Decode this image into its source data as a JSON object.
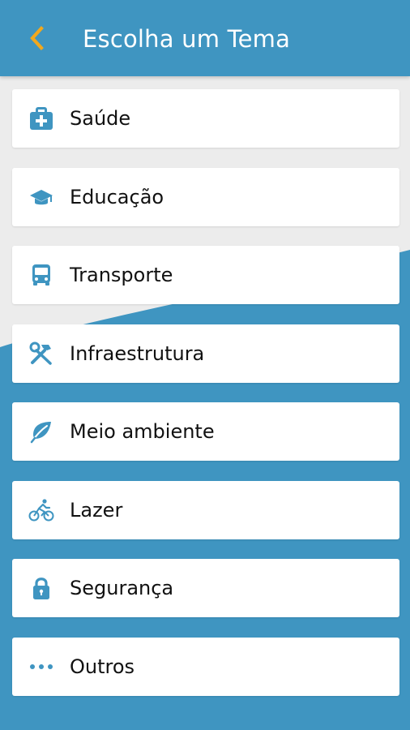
{
  "header": {
    "title": "Escolha um Tema",
    "back_icon": "chevron-left-icon"
  },
  "topics": [
    {
      "label": "Saúde",
      "icon": "medical-kit-icon"
    },
    {
      "label": "Educação",
      "icon": "graduation-cap-icon"
    },
    {
      "label": "Transporte",
      "icon": "bus-icon"
    },
    {
      "label": "Infraestrutura",
      "icon": "tools-icon"
    },
    {
      "label": "Meio ambiente",
      "icon": "leaf-icon"
    },
    {
      "label": "Lazer",
      "icon": "bicycle-icon"
    },
    {
      "label": "Segurança",
      "icon": "lock-icon"
    },
    {
      "label": "Outros",
      "icon": "more-dots-icon"
    }
  ],
  "colors": {
    "primary": "#3f95c1",
    "accent": "#f2a81d",
    "background": "#ececec",
    "card": "#ffffff",
    "text": "#111111"
  }
}
